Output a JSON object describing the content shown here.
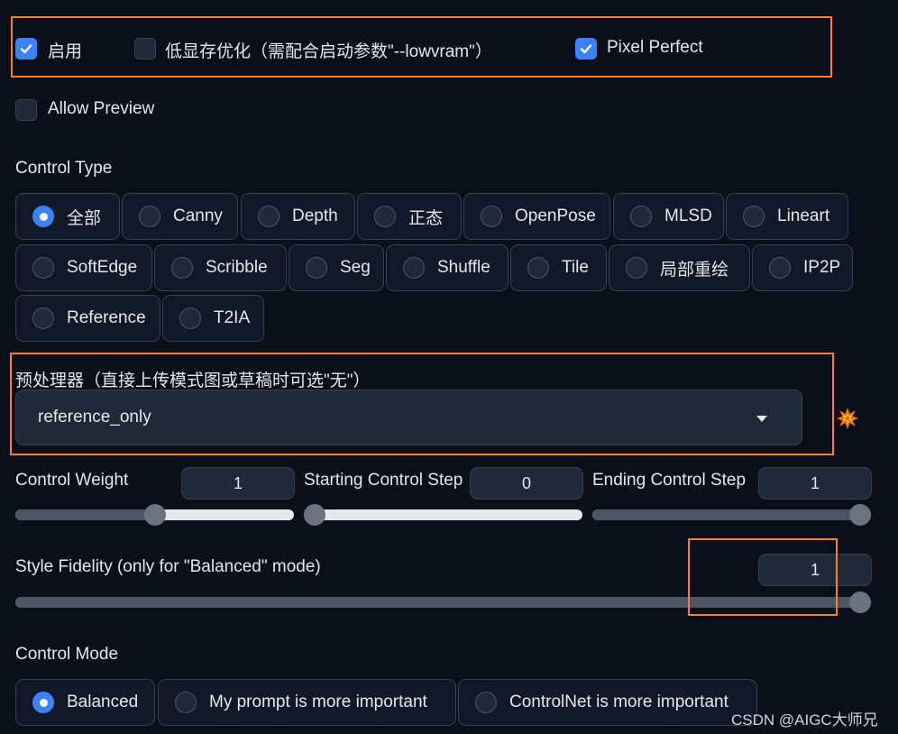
{
  "options": {
    "enable": {
      "label": "启用",
      "checked": true
    },
    "low_vram": {
      "label": "低显存优化（需配合启动参数\"--lowvram\"）",
      "checked": false
    },
    "pixel_perfect": {
      "label": "Pixel Perfect",
      "checked": true
    },
    "allow_preview": {
      "label": "Allow Preview",
      "checked": false
    }
  },
  "control_type": {
    "label": "Control Type",
    "selected": "全部",
    "items": [
      "全部",
      "Canny",
      "Depth",
      "正态",
      "OpenPose",
      "MLSD",
      "Lineart",
      "SoftEdge",
      "Scribble",
      "Seg",
      "Shuffle",
      "Tile",
      "局部重绘",
      "IP2P",
      "Reference",
      "T2IA"
    ]
  },
  "preprocessor": {
    "label": "预处理器（直接上传模式图或草稿时可选\"无\"）",
    "value": "reference_only",
    "icon": "explosion-icon"
  },
  "sliders": {
    "control_weight": {
      "label": "Control Weight",
      "value": "1",
      "fraction": 0.5
    },
    "starting_step": {
      "label": "Starting Control Step",
      "value": "0",
      "fraction": 0.0
    },
    "ending_step": {
      "label": "Ending Control Step",
      "value": "1",
      "fraction": 1.0
    },
    "style_fidelity": {
      "label": "Style Fidelity (only for \"Balanced\" mode)",
      "value": "1",
      "fraction": 1.0
    }
  },
  "control_mode": {
    "label": "Control Mode",
    "selected": "Balanced",
    "items": [
      "Balanced",
      "My prompt is more important",
      "ControlNet is more important"
    ]
  },
  "watermark": "CSDN @AIGC大师兄",
  "colors": {
    "accent": "#3b82f6",
    "highlight": "#ff7f27",
    "background": "#0b0f19"
  }
}
